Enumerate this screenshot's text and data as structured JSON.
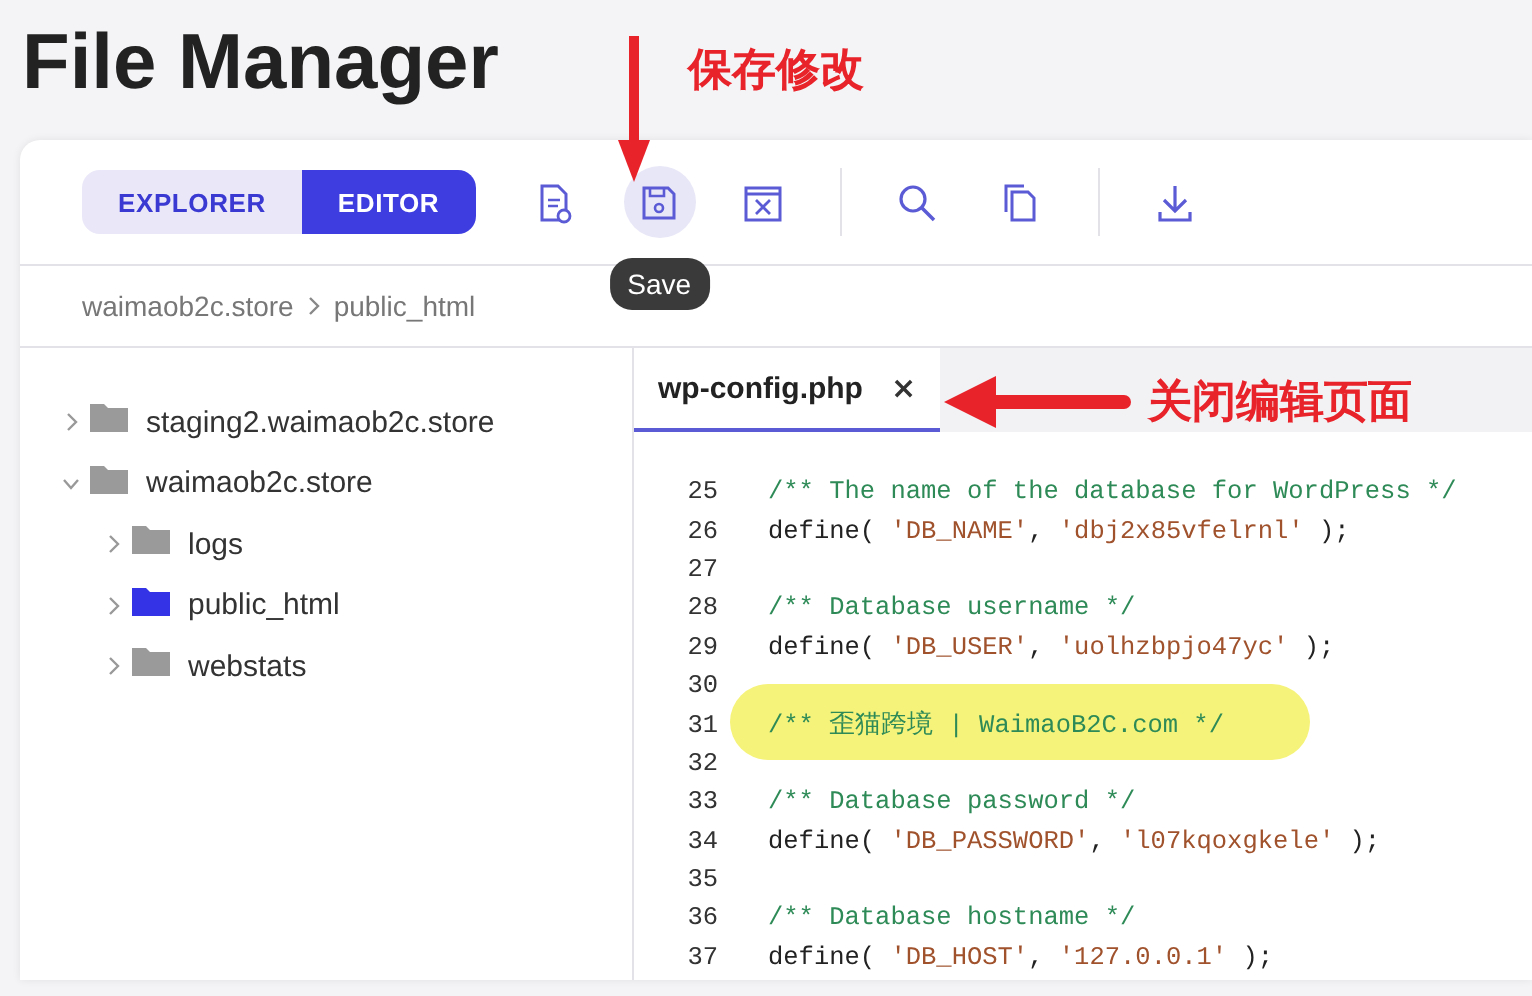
{
  "page_title": "File Manager",
  "annotations": [
    {
      "text": "保存修改",
      "kind": "down"
    },
    {
      "text": "关闭编辑页面",
      "kind": "left"
    }
  ],
  "toolbar": {
    "view_toggle": [
      {
        "label": "EXPLORER",
        "selected": false
      },
      {
        "label": "EDITOR",
        "selected": true
      }
    ],
    "tools": [
      {
        "kind": "new-file",
        "hovered": false
      },
      {
        "kind": "save",
        "hovered": true,
        "tooltip": "Save"
      },
      {
        "kind": "close-file",
        "hovered": false
      },
      {
        "kind": "divider"
      },
      {
        "kind": "search",
        "hovered": false
      },
      {
        "kind": "copy",
        "hovered": false
      },
      {
        "kind": "divider"
      },
      {
        "kind": "download",
        "hovered": false
      }
    ]
  },
  "breadcrumb": [
    "waimaob2c.store",
    "public_html"
  ],
  "tree": {
    "items": [
      {
        "label": "staging2.waimaob2c.store",
        "expanded": false,
        "selected": false
      },
      {
        "label": "waimaob2c.store",
        "expanded": true,
        "selected": false,
        "children": [
          {
            "label": "logs",
            "expanded": false,
            "selected": false
          },
          {
            "label": "public_html",
            "expanded": false,
            "selected": true
          },
          {
            "label": "webstats",
            "expanded": false,
            "selected": false
          }
        ]
      }
    ]
  },
  "editor": {
    "tabs": [
      {
        "label": "wp-config.php",
        "close": "×",
        "selected": true
      }
    ],
    "lines": [
      {
        "number": "25",
        "highlighted": false,
        "segments": [
          {
            "color": "#2e8b57",
            "text": "/** The name of the database for WordPress */"
          }
        ]
      },
      {
        "number": "26",
        "highlighted": false,
        "segments": [
          {
            "color": "#222222",
            "text": "define( "
          },
          {
            "color": "#a0522d",
            "text": "'DB_NAME'"
          },
          {
            "color": "#222222",
            "text": ", "
          },
          {
            "color": "#a0522d",
            "text": "'dbj2x85vfelrnl'"
          },
          {
            "color": "#222222",
            "text": " );"
          }
        ]
      },
      {
        "number": "27",
        "highlighted": false
      },
      {
        "number": "28",
        "highlighted": false,
        "segments": [
          {
            "color": "#2e8b57",
            "text": "/** Database username */"
          }
        ]
      },
      {
        "number": "29",
        "highlighted": false,
        "segments": [
          {
            "color": "#222222",
            "text": "define( "
          },
          {
            "color": "#a0522d",
            "text": "'DB_USER'"
          },
          {
            "color": "#222222",
            "text": ", "
          },
          {
            "color": "#a0522d",
            "text": "'uolhzbpjo47yc'"
          },
          {
            "color": "#222222",
            "text": " );"
          }
        ]
      },
      {
        "number": "30",
        "highlighted": false
      },
      {
        "number": "31",
        "highlighted": true,
        "segments": [
          {
            "color": "#2e8b57",
            "text": "/** 歪猫跨境 | WaimaoB2C.com */"
          }
        ]
      },
      {
        "number": "32",
        "highlighted": false
      },
      {
        "number": "33",
        "highlighted": false,
        "segments": [
          {
            "color": "#2e8b57",
            "text": "/** Database password */"
          }
        ]
      },
      {
        "number": "34",
        "highlighted": false,
        "segments": [
          {
            "color": "#222222",
            "text": "define( "
          },
          {
            "color": "#a0522d",
            "text": "'DB_PASSWORD'"
          },
          {
            "color": "#222222",
            "text": ", "
          },
          {
            "color": "#a0522d",
            "text": "'l07kqoxgkele'"
          },
          {
            "color": "#222222",
            "text": " );"
          }
        ]
      },
      {
        "number": "35",
        "highlighted": false
      },
      {
        "number": "36",
        "highlighted": false,
        "segments": [
          {
            "color": "#2e8b57",
            "text": "/** Database hostname */"
          }
        ]
      },
      {
        "number": "37",
        "highlighted": false,
        "segments": [
          {
            "color": "#222222",
            "text": "define( "
          },
          {
            "color": "#a0522d",
            "text": "'DB_HOST'"
          },
          {
            "color": "#222222",
            "text": ", "
          },
          {
            "color": "#a0522d",
            "text": "'127.0.0.1'"
          },
          {
            "color": "#222222",
            "text": " );"
          }
        ]
      }
    ]
  }
}
